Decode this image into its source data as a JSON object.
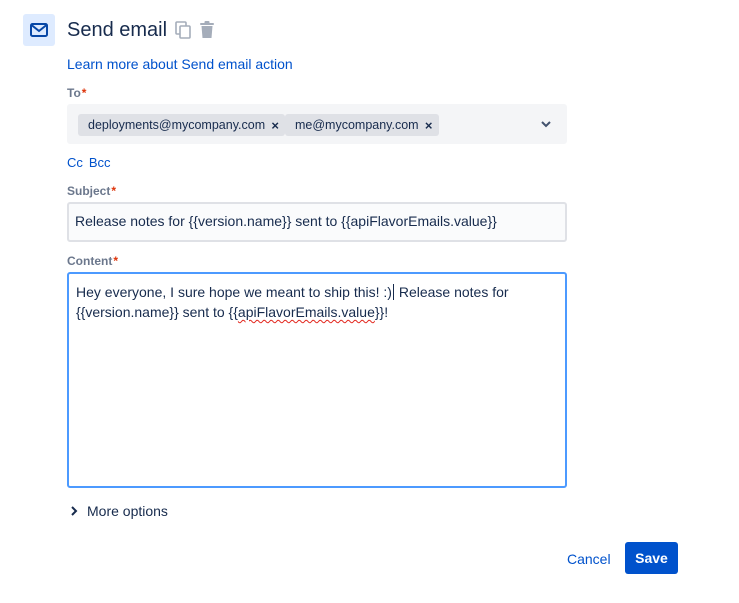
{
  "header": {
    "icon": "mail-icon",
    "title": "Send email",
    "actions": [
      "copy-icon",
      "trash-icon"
    ]
  },
  "learn_more_link": "Learn more about Send email action",
  "to": {
    "label": "To",
    "required_marker": "*",
    "recipients": [
      "deployments@mycompany.com",
      "me@mycompany.com"
    ],
    "remove_symbol": "×",
    "dropdown_icon": "chevron-down-icon"
  },
  "cc_bcc": {
    "cc_label": "Cc",
    "bcc_label": "Bcc"
  },
  "subject": {
    "label": "Subject",
    "required_marker": "*",
    "value": "Release notes for {{version.name}} sent to {{apiFlavorEmails.value}}"
  },
  "content": {
    "label": "Content",
    "required_marker": "*",
    "line1_before_caret": "Hey everyone, I sure hope we meant to ship this! :)",
    "line1_after_caret": " Release notes for",
    "line2_prefix": "{{version.name}} sent to {{",
    "line2_misspelled": "apiFlavorEmails.value",
    "line2_suffix": "}}!"
  },
  "more_options_label": "More options",
  "buttons": {
    "cancel": "Cancel",
    "save": "Save"
  },
  "colors": {
    "primary": "#0052cc",
    "focus_border": "#4c9aff",
    "required": "#de350b",
    "icon_bg": "#deebff"
  }
}
